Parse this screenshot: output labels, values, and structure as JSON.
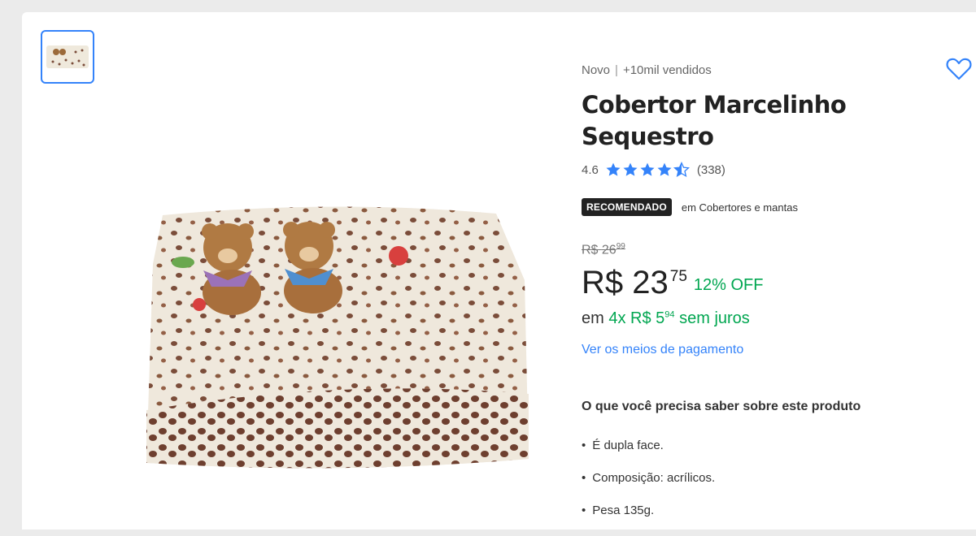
{
  "product": {
    "condition": "Novo",
    "separator": "|",
    "sold": "+10mil vendidos",
    "title": "Cobertor Marcelinho Sequestro",
    "rating": {
      "value": "4.6",
      "stars": 4.5,
      "count": "(338)"
    },
    "badge": {
      "label": "RECOMENDADO",
      "category": "em Cobertores e mantas"
    },
    "old_price": {
      "currency": "R$",
      "integer": "26",
      "cents": "99"
    },
    "price": {
      "integer": "R$ 23",
      "cents": "75",
      "discount": "12% OFF"
    },
    "installments": {
      "prefix": "em",
      "plan": "4x R$ 5",
      "cents": "94",
      "suffix": "sem juros"
    },
    "payment_link": "Ver os meios de pagamento",
    "features_title": "O que você precisa saber sobre este produto",
    "features": [
      "É dupla face.",
      "Composição: acrílicos.",
      "Pesa 135g."
    ]
  },
  "icons": {
    "favorite": "heart-outline-icon",
    "star": "star-icon"
  },
  "colors": {
    "accent": "#3483fa",
    "green": "#00a650",
    "badge": "#222222"
  }
}
